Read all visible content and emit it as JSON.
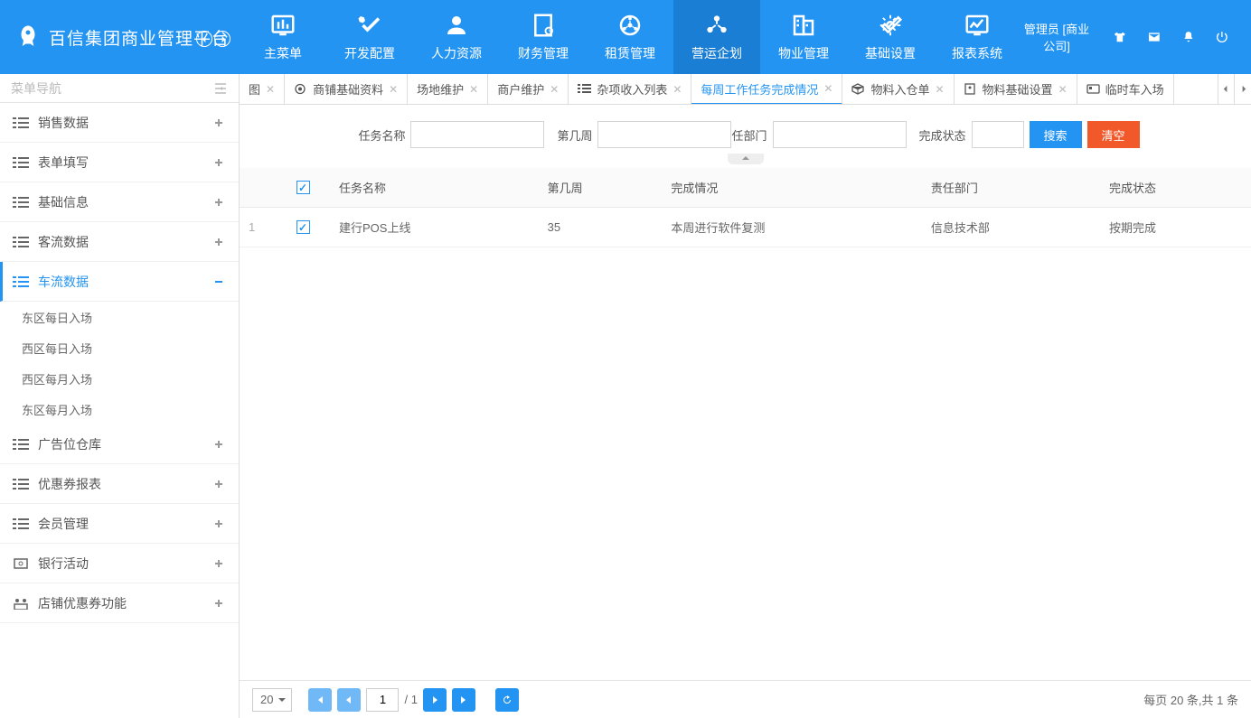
{
  "app_title": "百信集团商业管理平台",
  "user_label": "管理员 [商业公司]",
  "top_nav": [
    {
      "label": "主菜单",
      "active": false
    },
    {
      "label": "开发配置",
      "active": false
    },
    {
      "label": "人力资源",
      "active": false
    },
    {
      "label": "财务管理",
      "active": false
    },
    {
      "label": "租赁管理",
      "active": false
    },
    {
      "label": "营运企划",
      "active": true
    },
    {
      "label": "物业管理",
      "active": false
    },
    {
      "label": "基础设置",
      "active": false
    },
    {
      "label": "报表系统",
      "active": false
    }
  ],
  "sidebar": {
    "title": "菜单导航",
    "groups": [
      {
        "label": "销售数据",
        "expanded": false
      },
      {
        "label": "表单填写",
        "expanded": false
      },
      {
        "label": "基础信息",
        "expanded": false
      },
      {
        "label": "客流数据",
        "expanded": false
      },
      {
        "label": "车流数据",
        "expanded": true,
        "children": [
          {
            "label": "东区每日入场"
          },
          {
            "label": "西区每日入场"
          },
          {
            "label": "西区每月入场"
          },
          {
            "label": "东区每月入场"
          }
        ]
      },
      {
        "label": "广告位仓库",
        "expanded": false
      },
      {
        "label": "优惠券报表",
        "expanded": false
      },
      {
        "label": "会员管理",
        "expanded": false
      },
      {
        "label": "银行活动",
        "expanded": false,
        "icon": "bank"
      },
      {
        "label": "店铺优惠券功能",
        "expanded": false,
        "icon": "shop"
      }
    ]
  },
  "tabs": [
    {
      "label": "图",
      "icon": null,
      "closable": true
    },
    {
      "label": "商铺基础资料",
      "icon": "target",
      "closable": true
    },
    {
      "label": "场地维护",
      "icon": null,
      "closable": true
    },
    {
      "label": "商户维护",
      "icon": null,
      "closable": true
    },
    {
      "label": "杂项收入列表",
      "icon": "list",
      "closable": true
    },
    {
      "label": "每周工作任务完成情况",
      "icon": null,
      "closable": true,
      "active": true
    },
    {
      "label": "物料入仓单",
      "icon": "cube",
      "closable": true
    },
    {
      "label": "物料基础设置",
      "icon": "doc",
      "closable": true
    },
    {
      "label": "临时车入场",
      "icon": "card",
      "closable": false
    }
  ],
  "search": {
    "fields": [
      {
        "label": "任务名称",
        "value": ""
      },
      {
        "label": "第几周",
        "value": ""
      },
      {
        "label": "责任部门",
        "value": "",
        "partial": "任部门"
      },
      {
        "label": "完成状态",
        "value": ""
      }
    ],
    "search_btn": "搜索",
    "clear_btn": "清空"
  },
  "table": {
    "columns": [
      "任务名称",
      "第几周",
      "完成情况",
      "责任部门",
      "完成状态"
    ],
    "rows": [
      {
        "idx": "1",
        "checked": true,
        "cells": [
          "建行POS上线",
          "35",
          "本周进行软件复测",
          "信息技术部",
          "按期完成"
        ]
      }
    ]
  },
  "pager": {
    "page_size": "20",
    "current": "1",
    "total_pages": "/ 1",
    "info": "每页 20 条,共 1 条"
  }
}
